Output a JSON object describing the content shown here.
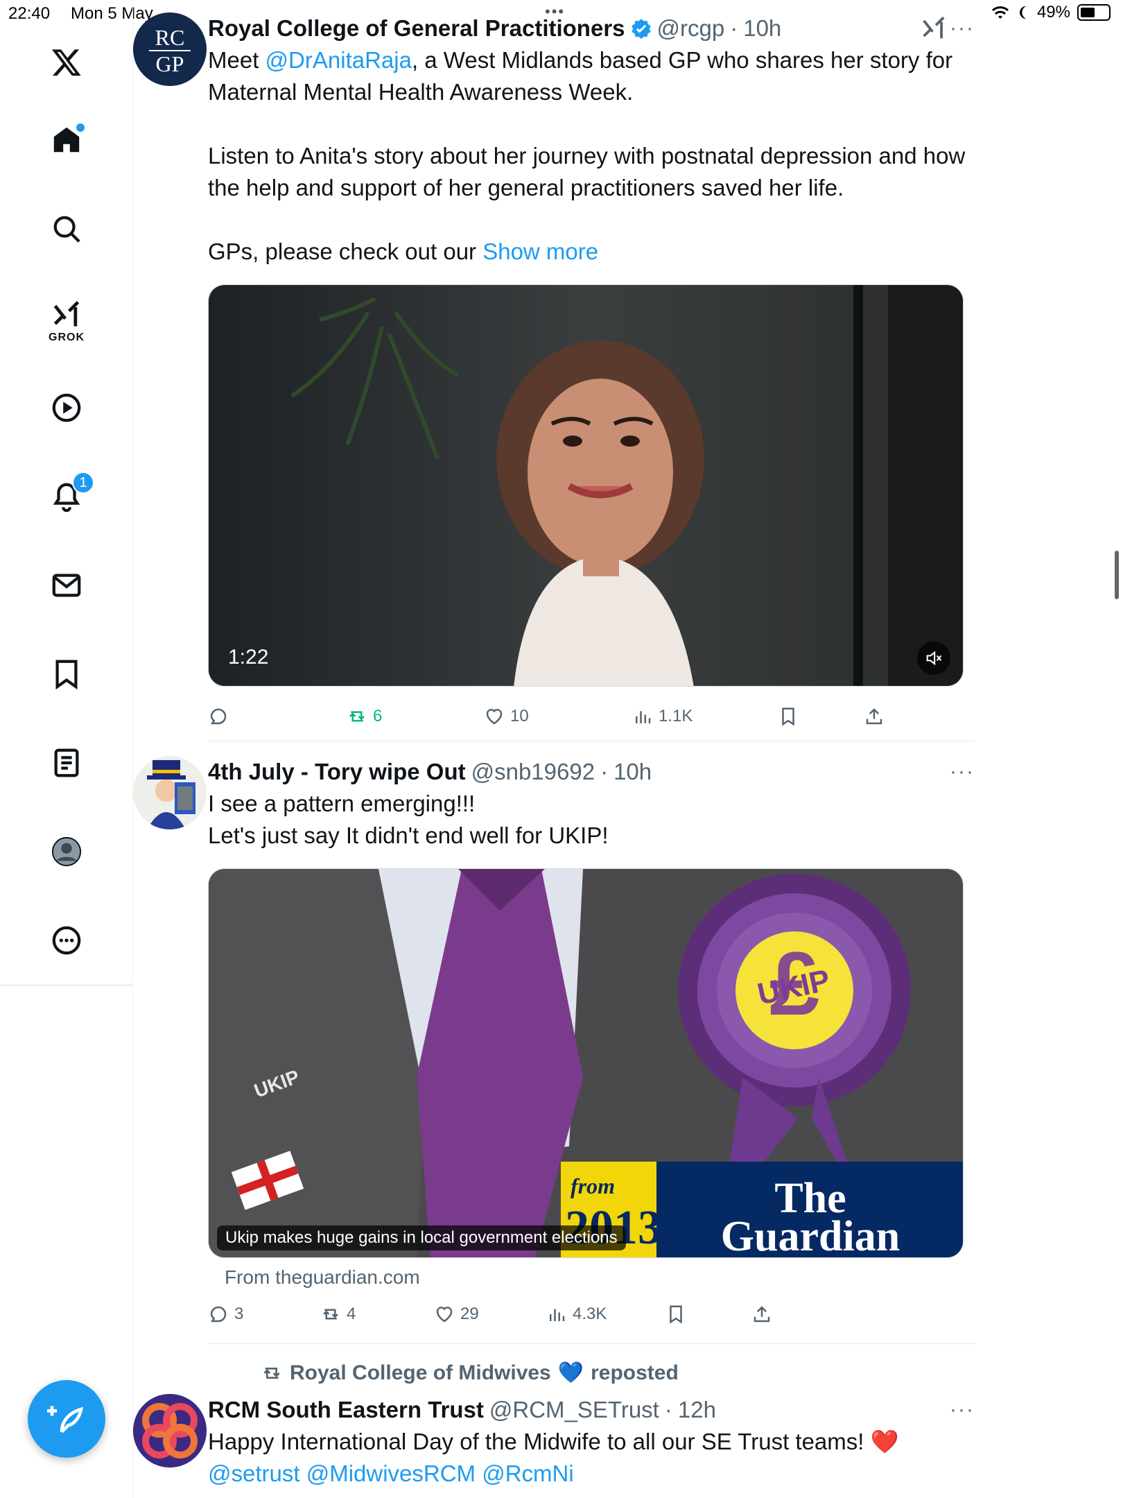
{
  "status_bar": {
    "time": "22:40",
    "date": "Mon 5 May",
    "battery": "49%"
  },
  "sidebar": {
    "items": [
      {
        "name": "x-logo-icon"
      },
      {
        "name": "home-icon"
      },
      {
        "name": "search-icon"
      },
      {
        "name": "grok-icon",
        "label": "GROK"
      },
      {
        "name": "video-icon"
      },
      {
        "name": "notifications-icon",
        "badge": "1"
      },
      {
        "name": "messages-icon"
      },
      {
        "name": "bookmarks-icon"
      },
      {
        "name": "lists-icon"
      },
      {
        "name": "profile-icon"
      },
      {
        "name": "more-icon"
      }
    ],
    "compose_icon": "compose-icon"
  },
  "colors": {
    "accent": "#1d9bf0",
    "repost_green": "#00ba7c",
    "secondary_text": "#536471"
  },
  "tweets": [
    {
      "name": "Royal College of General Practitioners",
      "handle": "@rcgp",
      "time": "10h",
      "avatar_text_1": "RC",
      "avatar_text_2": "GP",
      "text_meet": "Meet ",
      "mention": "@DrAnitaRaja",
      "text_line1_rest": ", a West Midlands based GP who shares her story for Maternal Mental Health Awareness Week.",
      "text_para2": "Listen to Anita's story about her journey with postnatal depression and how the help and support of her general practitioners saved her life.",
      "text_para3": "GPs, please check out our ",
      "show_more": "Show more",
      "video_duration": "1:22",
      "stats": {
        "replies": "",
        "reposts": "6",
        "likes": "10",
        "views": "1.1K"
      }
    },
    {
      "name": "4th July - Tory wipe Out",
      "handle": "@snb19692",
      "time": "10h",
      "text_line1": "I see a pattern emerging!!!",
      "text_line2": "Let's just say It didn't end well for UKIP!",
      "media": {
        "rosette_text": "UKIP",
        "pin_text": "UKIP",
        "from_label": "from",
        "year": "2013",
        "brand_line1": "The",
        "brand_line2": "Guardian",
        "caption": "Ukip makes huge gains in local government elections"
      },
      "source": "From theguardian.com",
      "stats": {
        "replies": "3",
        "reposts": "4",
        "likes": "29",
        "views": "4.3K"
      }
    },
    {
      "reposted_by": "Royal College of Midwives",
      "reposted_heart": "💙",
      "reposted_label": "reposted",
      "name": "RCM South Eastern Trust",
      "handle": "@RCM_SETrust",
      "time": "12h",
      "text_line1": "Happy International Day of the Midwife to all our SE Trust teams! ❤️",
      "mentions": "@setrust @MidwivesRCM @RcmNi"
    }
  ]
}
